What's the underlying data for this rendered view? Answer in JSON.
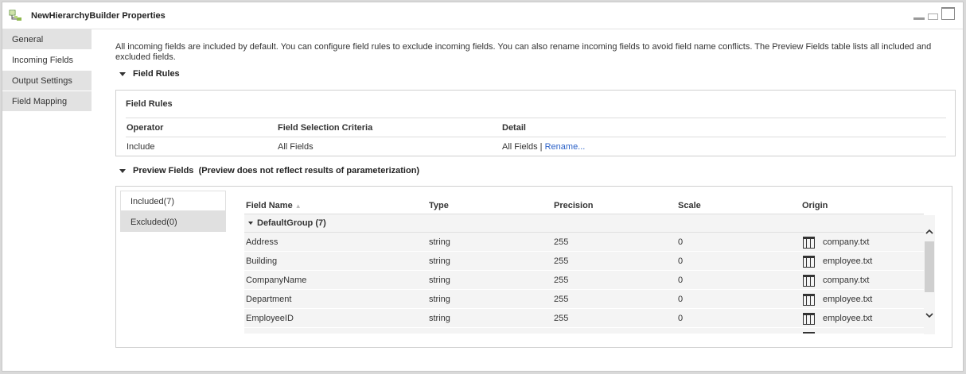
{
  "window": {
    "title": "NewHierarchyBuilder Properties",
    "app_icon": "hierarchy-builder-icon"
  },
  "sidebar": {
    "items": [
      {
        "label": "General",
        "active": false
      },
      {
        "label": "Incoming Fields",
        "active": true
      },
      {
        "label": "Output Settings",
        "active": false
      },
      {
        "label": "Field Mapping",
        "active": false
      }
    ]
  },
  "description": "All incoming fields are included by default. You can configure field rules to exclude incoming fields. You can also rename incoming fields to avoid field name conflicts. The Preview Fields table lists all included and excluded fields.",
  "field_rules": {
    "section_label": "Field Rules",
    "panel_title": "Field Rules",
    "columns": [
      "Operator",
      "Field Selection Criteria",
      "Detail"
    ],
    "row": {
      "operator": "Include",
      "criteria": "All Fields",
      "detail": "All Fields |",
      "rename_link": "Rename..."
    }
  },
  "preview": {
    "section_label": "Preview Fields",
    "note": "(Preview does not reflect results of parameterization)",
    "tabs": [
      "Included(7)",
      "Excluded(0)"
    ],
    "columns": [
      "Field Name",
      "Type",
      "Precision",
      "Scale",
      "Origin"
    ],
    "group_label": "DefaultGroup (7)",
    "rows": [
      {
        "name": "Address",
        "type": "string",
        "precision": "255",
        "scale": "0",
        "origin": "company.txt"
      },
      {
        "name": "Building",
        "type": "string",
        "precision": "255",
        "scale": "0",
        "origin": "employee.txt"
      },
      {
        "name": "CompanyName",
        "type": "string",
        "precision": "255",
        "scale": "0",
        "origin": "company.txt"
      },
      {
        "name": "Department",
        "type": "string",
        "precision": "255",
        "scale": "0",
        "origin": "employee.txt"
      },
      {
        "name": "EmployeeID",
        "type": "string",
        "precision": "255",
        "scale": "0",
        "origin": "employee.txt"
      }
    ]
  },
  "colors": {
    "link": "#2c62c8",
    "nav_bg": "#e2e2e2",
    "grid_bg": "#f4f4f4"
  }
}
